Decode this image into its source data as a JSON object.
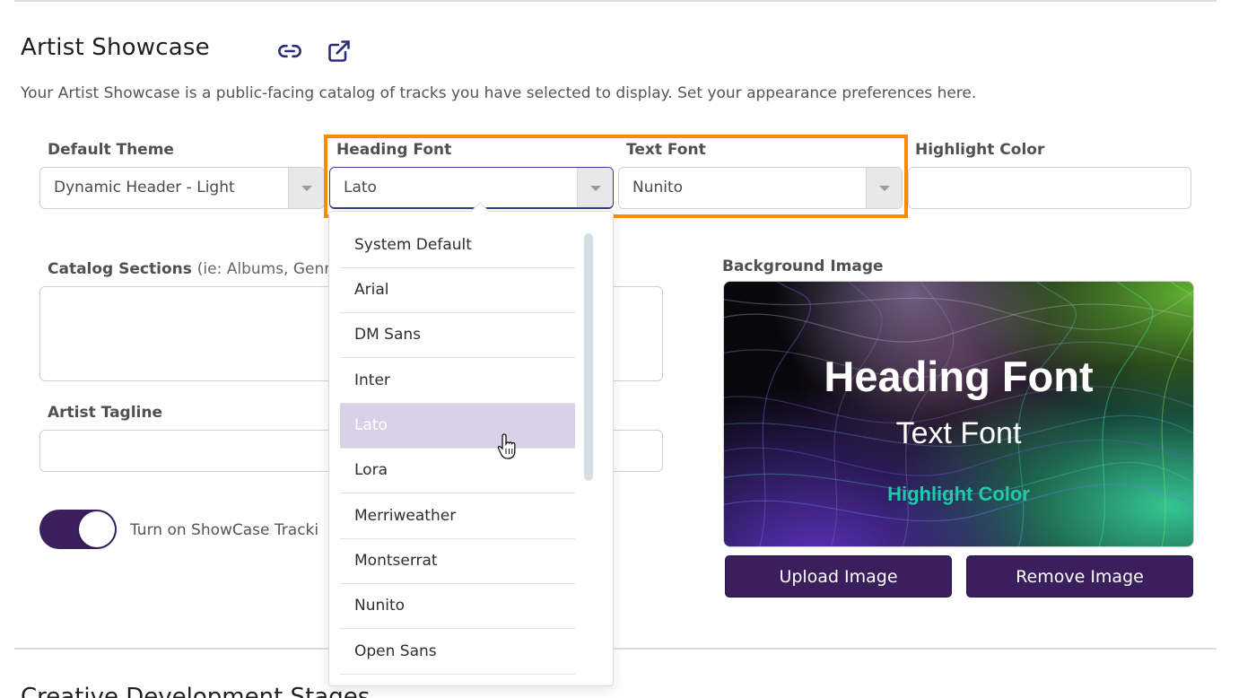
{
  "section": {
    "title": "Artist Showcase",
    "description": "Your Artist Showcase is a public-facing catalog of tracks you have selected to display. Set your appearance preferences here.",
    "icons": [
      "link-icon",
      "external-link-icon"
    ]
  },
  "fields": {
    "default_theme": {
      "label": "Default Theme",
      "value": "Dynamic Header - Light"
    },
    "heading_font": {
      "label": "Heading Font",
      "value": "Lato"
    },
    "text_font": {
      "label": "Text Font",
      "value": "Nunito"
    },
    "highlight_color": {
      "label": "Highlight Color",
      "value": ""
    },
    "catalog_sections": {
      "label": "Catalog Sections",
      "hint": "(ie: Albums, Genre"
    },
    "artist_tagline": {
      "label": "Artist Tagline",
      "value": ""
    },
    "background_image": {
      "label": "Background Image"
    }
  },
  "dropdown": {
    "options": [
      "System Default",
      "Arial",
      "DM Sans",
      "Inter",
      "Lato",
      "Lora",
      "Merriweather",
      "Montserrat",
      "Nunito",
      "Open Sans"
    ],
    "selected": "Lato"
  },
  "toggle": {
    "label": "Turn on ShowCase Tracki",
    "on": true
  },
  "preview": {
    "heading": "Heading Font",
    "text": "Text Font",
    "highlight": "Highlight Color"
  },
  "buttons": {
    "upload": "Upload Image",
    "remove": "Remove Image"
  },
  "next_section": {
    "title": "Creative Development Stages"
  },
  "colors": {
    "accent_purple": "#3a1f5c",
    "focus_outline": "#ff8a00",
    "selected_option": "#d8d1e8",
    "preview_highlight": "#20c9a8"
  }
}
